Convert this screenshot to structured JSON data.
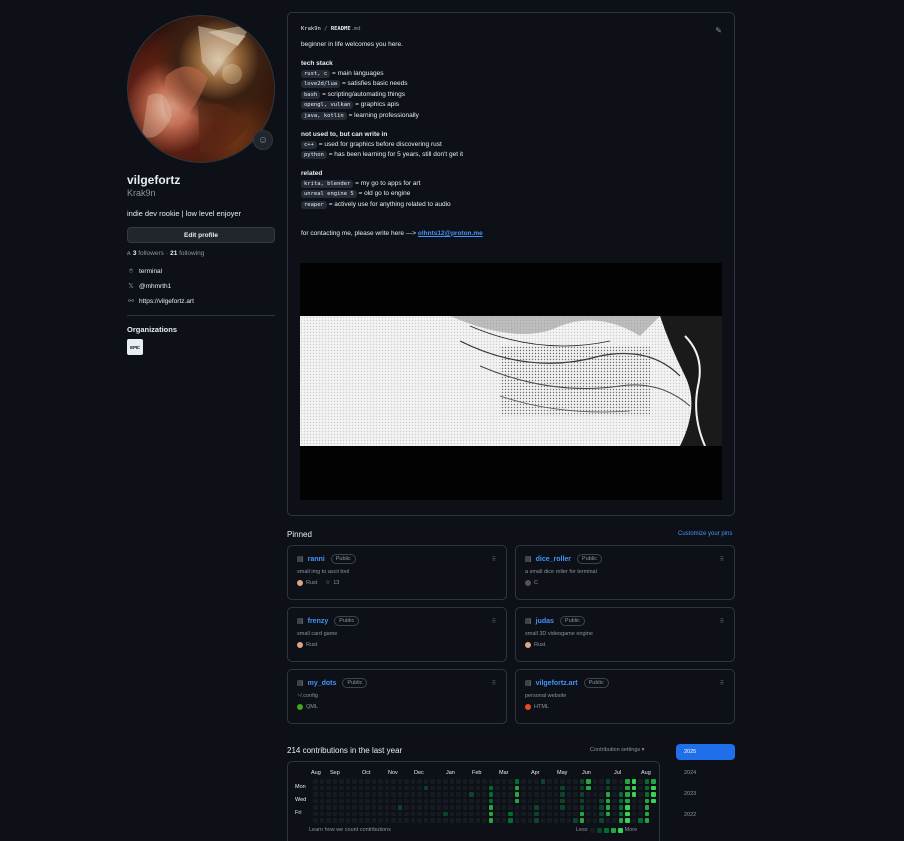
{
  "profile": {
    "fullname": "vilgefortz",
    "username": "Krak9n",
    "bio": "indie dev rookie | low level enjoyer",
    "edit_label": "Edit profile",
    "followers_count": "3",
    "followers_label": "followers",
    "following_count": "21",
    "following_label": "following",
    "location": "terminal",
    "twitter": "@mhmrth1",
    "website": "https://vilgefortz.art",
    "status_emoji": "☺"
  },
  "organizations": {
    "title": "Organizations",
    "items": [
      {
        "label": "EPIC"
      }
    ]
  },
  "readme": {
    "owner": "Krak9n",
    "sep": " / ",
    "file": "README",
    "ext": ".md",
    "intro": "beginner in life welcomes you here.",
    "tech_title": "tech stack",
    "tech": [
      {
        "code": "rust, c",
        "text": "= main languages"
      },
      {
        "code": "love2d/lua",
        "text": "= satisfies basic needs"
      },
      {
        "code": "bash",
        "text": "= scripting/automating things"
      },
      {
        "code": "opengl, vulkan",
        "text": "= graphics apis"
      },
      {
        "code": "java, kotlin",
        "text": "= learning professionally"
      }
    ],
    "unused_title": "not used to, but can write in",
    "unused": [
      {
        "code": "c++",
        "text": "= used for graphics before discovering rust"
      },
      {
        "code": "python",
        "text": "= has been learning for 5 years, still don't get it"
      }
    ],
    "related_title": "related",
    "related": [
      {
        "code": "krita, blender",
        "text": "= my go to apps for art"
      },
      {
        "code": "unreal engine 5",
        "text": "= old go to engine"
      },
      {
        "code": "reaper",
        "text": "= actively use for anything related to audio"
      }
    ],
    "contact_prefix": "for contacting me, please write here --->",
    "email": "olhnts12@proton.me"
  },
  "pinned": {
    "title": "Pinned",
    "customize": "Customize your pins",
    "repos": [
      {
        "name": "ranni",
        "visibility": "Public",
        "desc": "small img to ascii tool",
        "lang": "Rust",
        "lang_color": "#dea584",
        "stars": "13"
      },
      {
        "name": "dice_roller",
        "visibility": "Public",
        "desc": "a small dice roller for terminal",
        "lang": "C",
        "lang_color": "#555555",
        "stars": ""
      },
      {
        "name": "frenzy",
        "visibility": "Public",
        "desc": "small card game",
        "lang": "Rust",
        "lang_color": "#dea584",
        "stars": ""
      },
      {
        "name": "judas",
        "visibility": "Public",
        "desc": "small 3D videogame engine",
        "lang": "Rust",
        "lang_color": "#dea584",
        "stars": ""
      },
      {
        "name": "my_dots",
        "visibility": "Public",
        "desc": "~/.config",
        "lang": "QML",
        "lang_color": "#44a51c",
        "stars": ""
      },
      {
        "name": "vilgefortz.art",
        "visibility": "Public",
        "desc": "personal website",
        "lang": "HTML",
        "lang_color": "#e34c26",
        "stars": ""
      }
    ]
  },
  "contributions": {
    "title": "214 contributions in the last year",
    "settings": "Contribution settings",
    "months": [
      "Aug",
      "Sep",
      "Oct",
      "Nov",
      "Dec",
      "Jan",
      "Feb",
      "Mar",
      "Apr",
      "May",
      "Jun",
      "Jul",
      "Aug"
    ],
    "days": [
      "Mon",
      "Wed",
      "Fri"
    ],
    "learn": "Learn how we count contributions",
    "less": "Less",
    "more": "More",
    "colors": [
      "#161b22",
      "#0e4429",
      "#006d32",
      "#26a641",
      "#39d353"
    ],
    "years": [
      "2025",
      "2024",
      "2023",
      "2022"
    ]
  }
}
